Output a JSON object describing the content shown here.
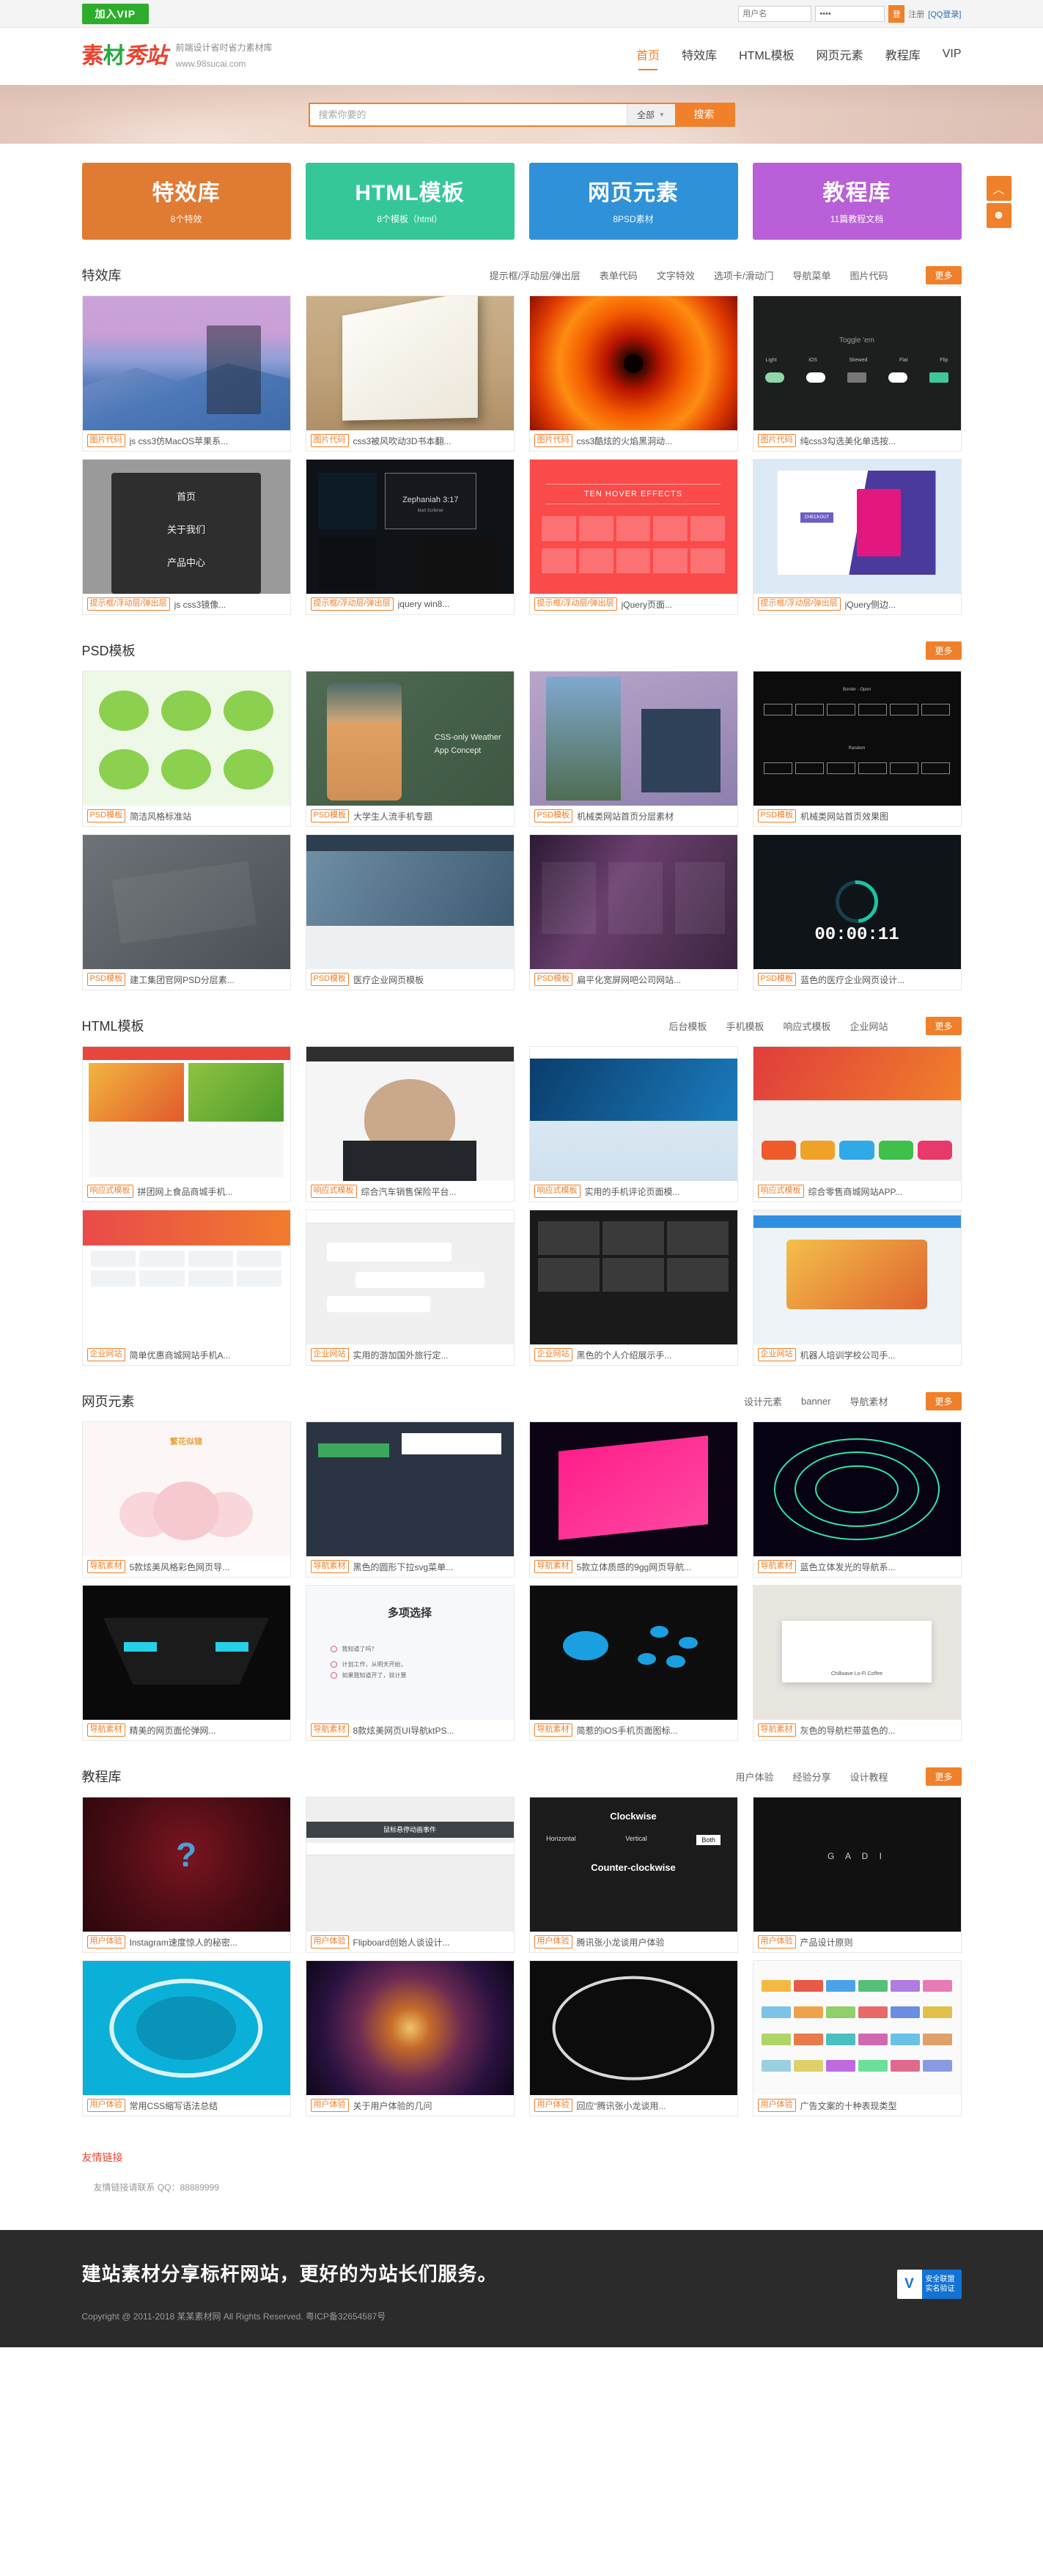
{
  "topbar": {
    "vip_label": "加入VIP",
    "username_placeholder": "用户名",
    "password_value": "••••",
    "login_label": "登",
    "register_label": "注册",
    "qq_login_label": "[QQ登录]"
  },
  "header": {
    "logo_text": "素材秀站",
    "logo_char1": "素",
    "logo_char2": "材",
    "logo_char3": "秀站",
    "slogan": "前端设计省时省力素材库",
    "url": "www.98sucai.com",
    "nav": [
      {
        "label": "首页",
        "active": true
      },
      {
        "label": "特效库",
        "active": false
      },
      {
        "label": "HTML模板",
        "active": false
      },
      {
        "label": "网页元素",
        "active": false
      },
      {
        "label": "教程库",
        "active": false
      },
      {
        "label": "VIP",
        "active": false
      }
    ]
  },
  "search": {
    "placeholder": "搜索你要的",
    "scope": "全部",
    "button": "搜索"
  },
  "side_float": {
    "top_icon": "chevron-up-icon",
    "contact_icon": "user-icon"
  },
  "categories": [
    {
      "title": "特效库",
      "sub": "8个特效",
      "color": "#e07b33"
    },
    {
      "title": "HTML模板",
      "sub": "8个模板（html）",
      "color": "#35c79a"
    },
    {
      "title": "网页元素",
      "sub": "8PSD素材",
      "color": "#2f92d8"
    },
    {
      "title": "教程库",
      "sub": "11篇教程文档",
      "color": "#b95fd8"
    }
  ],
  "sections": [
    {
      "title": "特效库",
      "filters": [
        "提示框/浮动层/弹出层",
        "表单代码",
        "文字特效",
        "选项卡/滑动门",
        "导航菜单",
        "图片代码"
      ],
      "more": "更多",
      "cards": [
        {
          "tag": "图片代码",
          "title": "js css3仿MacOS苹果系...",
          "art": "t-mac"
        },
        {
          "tag": "图片代码",
          "title": "css3被风吹动3D书本翻...",
          "art": "t-book"
        },
        {
          "tag": "图片代码",
          "title": "css3酷炫的火焰黑洞动...",
          "art": "t-fire"
        },
        {
          "tag": "图片代码",
          "title": "纯css3勾选美化单选按...",
          "art": "t-dark"
        },
        {
          "tag": "提示框/浮动层/弹出层",
          "title": "js css3镜像...",
          "art": "t-menu"
        },
        {
          "tag": "提示框/浮动层/弹出层",
          "title": "jquery win8...",
          "art": "t-win8"
        },
        {
          "tag": "提示框/浮动层/弹出层",
          "title": "jQuery页面...",
          "art": "t-hover"
        },
        {
          "tag": "提示框/浮动层/弹出层",
          "title": "jQuery侧边...",
          "art": "t-side"
        }
      ]
    },
    {
      "title": "PSD模板",
      "filters": [],
      "more": "更多",
      "cards": [
        {
          "tag": "PSD模板",
          "title": "简洁风格标准站",
          "art": "t-frog"
        },
        {
          "tag": "PSD模板",
          "title": "大学生人流手机专题",
          "art": "t-weather"
        },
        {
          "tag": "PSD模板",
          "title": "机械类网站首页分层素材",
          "art": "t-steps"
        },
        {
          "tag": "PSD模板",
          "title": "机械类网站首页效果图",
          "art": "t-border"
        },
        {
          "tag": "PSD模板",
          "title": "建工集团官网PSD分层素...",
          "art": "t-grey"
        },
        {
          "tag": "PSD模板",
          "title": "医疗企业网页模板",
          "art": "t-med"
        },
        {
          "tag": "PSD模板",
          "title": "扁平化宽屏网吧公司网站...",
          "art": "t-purp"
        },
        {
          "tag": "PSD模板",
          "title": "蓝色的医疗企业网页设计...",
          "art": "t-timer"
        }
      ]
    },
    {
      "title": "HTML模板",
      "filters": [
        "后台模板",
        "手机模板",
        "响应式模板",
        "企业网站"
      ],
      "more": "更多",
      "cards": [
        {
          "tag": "响应式模板",
          "title": "拼团网上食品商城手机...",
          "art": "t-food"
        },
        {
          "tag": "响应式模板",
          "title": "综合汽车销售保险平台...",
          "art": "t-person"
        },
        {
          "tag": "响应式模板",
          "title": "实用的手机评论页面模...",
          "art": "t-tech"
        },
        {
          "tag": "响应式模板",
          "title": "综合零售商城网站APP...",
          "art": "t-app"
        },
        {
          "tag": "企业网站",
          "title": "简单优惠商城网站手机A...",
          "art": "t-mall"
        },
        {
          "tag": "企业网站",
          "title": "实用的游加国外旅行定...",
          "art": "t-chat"
        },
        {
          "tag": "企业网站",
          "title": "黑色的个人介绍展示手...",
          "art": "t-trip"
        },
        {
          "tag": "企业网站",
          "title": "机器人培训学校公司手...",
          "art": "t-robot"
        }
      ]
    },
    {
      "title": "网页元素",
      "filters": [
        "设计元素",
        "banner",
        "导航素材"
      ],
      "more": "更多",
      "cards": [
        {
          "tag": "导航素材",
          "title": "5款炫美风格彩色网页导...",
          "art": "t-lotus"
        },
        {
          "tag": "导航素材",
          "title": "黑色的圆形下拉svg菜单...",
          "art": "t-drop"
        },
        {
          "tag": "导航素材",
          "title": "5款立体质感的9gg网页导航...",
          "art": "t-neon"
        },
        {
          "tag": "导航素材",
          "title": "蓝色立体发光的导航系...",
          "art": "t-spiral"
        },
        {
          "tag": "导航素材",
          "title": "精美的网页面伦弹网...",
          "art": "t-robo"
        },
        {
          "tag": "导航素材",
          "title": "8款炫美网页UI导航ktPS...",
          "art": "t-check"
        },
        {
          "tag": "导航素材",
          "title": "简惹的iOS手机页面图标...",
          "art": "t-ios"
        },
        {
          "tag": "导航素材",
          "title": "灰色的导航栏带蓝色的...",
          "art": "t-coffee"
        }
      ]
    },
    {
      "title": "教程库",
      "filters": [
        "用户体验",
        "经验分享",
        "设计教程"
      ],
      "more": "更多",
      "cards": [
        {
          "tag": "用户体验",
          "title": "Instagram速度惊人的秘密...",
          "art": "t-q"
        },
        {
          "tag": "用户体验",
          "title": "Flipboard创始人谈设计...",
          "art": "t-flip"
        },
        {
          "tag": "用户体验",
          "title": "腾讯张小龙谈用户体验",
          "art": "t-clock"
        },
        {
          "tag": "用户体验",
          "title": "产品设计原则",
          "art": "t-blk"
        },
        {
          "tag": "用户体验",
          "title": "常用CSS缩写语法总结",
          "art": "t-css"
        },
        {
          "tag": "用户体验",
          "title": "关于用户体验的几问",
          "art": "t-galaxy"
        },
        {
          "tag": "用户体验",
          "title": "回应“腾讯张小龙谈用...",
          "art": "t-gauge"
        },
        {
          "tag": "用户体验",
          "title": "广告文案的十种表现类型",
          "art": "t-ad"
        }
      ]
    }
  ],
  "friend_links": {
    "title": "友情链接",
    "note": "友情链接请联系 QQ：88889999"
  },
  "footer": {
    "slogan": "建站素材分享标杆网站，更好的为站长们服务。",
    "copyright": "Copyright @ 2011-2018 某某素材网 All Rights Reserved. 粤ICP备32654587号",
    "seal_letter": "V",
    "seal_line1": "安全联盟",
    "seal_line2": "实名验证"
  }
}
